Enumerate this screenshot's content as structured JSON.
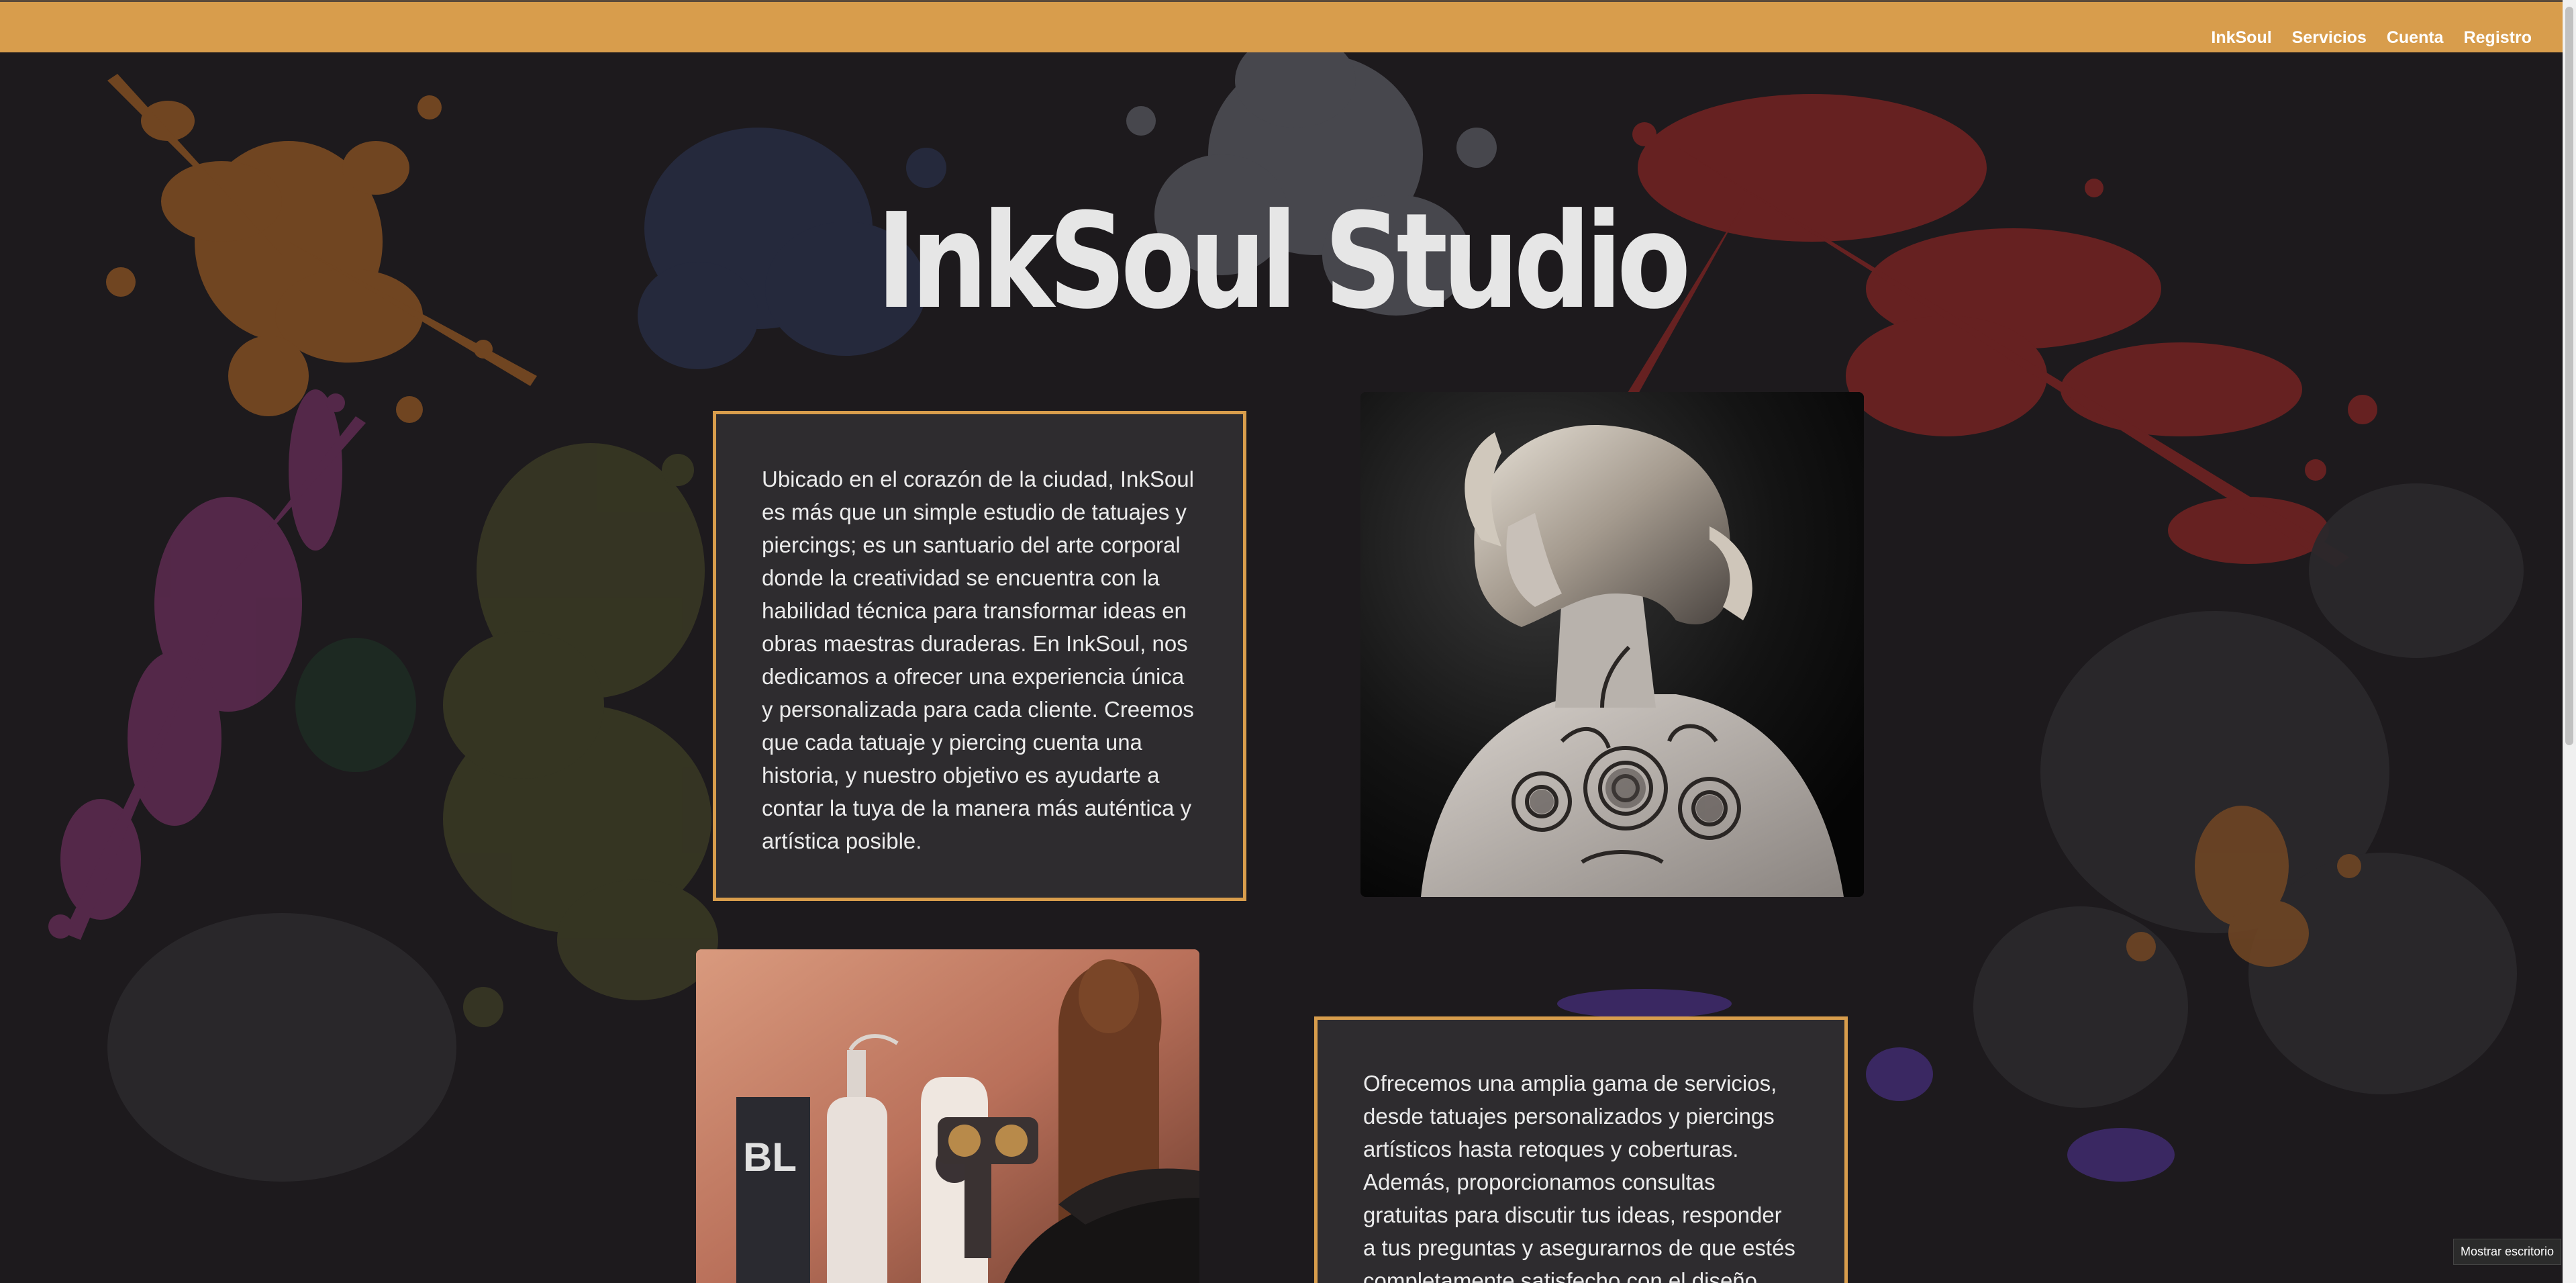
{
  "nav": {
    "links": [
      {
        "label": "InkSoul"
      },
      {
        "label": "Servicios"
      },
      {
        "label": "Cuenta"
      },
      {
        "label": "Registro"
      }
    ]
  },
  "hero": {
    "title": "InkSoul Studio"
  },
  "about": {
    "text": "Ubicado en el corazón de la ciudad, InkSoul es más que un simple estudio de tatuajes y piercings; es un santuario del arte corporal donde la creatividad se encuentra con la habilidad técnica para transformar ideas en obras maestras duraderas. En InkSoul, nos dedicamos a ofrecer una experiencia única y personalizada para cada cliente. Creemos que cada tatuaje y piercing cuenta una historia, y nuestro objetivo es ayudarte a contar la tuya de la manera más auténtica y artística posible."
  },
  "services": {
    "text": "Ofrecemos una amplia gama de servicios, desde tatuajes personalizados y piercings artísticos hasta retoques y coberturas. Además, proporcionamos consultas gratuitas para discutir tus ideas, responder a tus preguntas y asegurarnos de que estés completamente satisfecho con el diseño"
  },
  "taskbar": {
    "show_desktop": "Mostrar escritorio"
  },
  "colors": {
    "accent": "#d89d4c",
    "background": "#1d1a1d",
    "box_background": "#2e2c2f",
    "title": "#e6e6e6"
  },
  "images": {
    "woman_photo": "woman-with-back-floral-tattoo-photo",
    "machine_photo": "tattoo-machine-and-ink-bottles-photo"
  }
}
